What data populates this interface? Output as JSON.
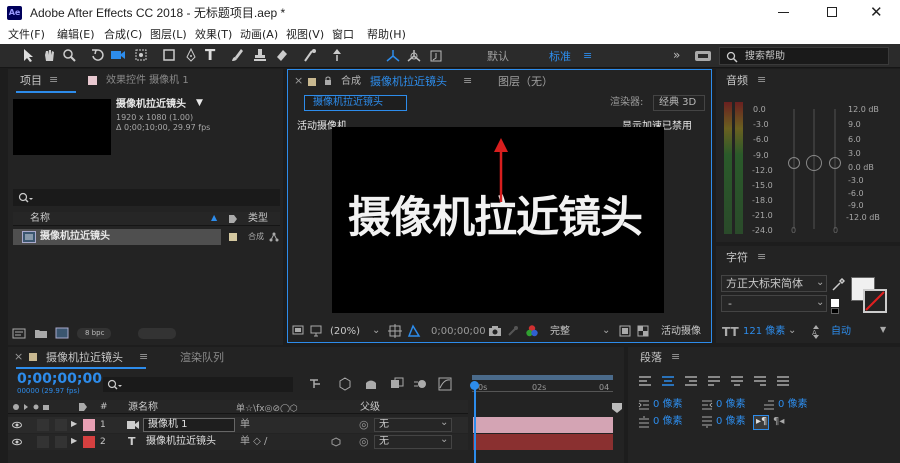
{
  "window": {
    "title": "Adobe After Effects CC 2018 - 无标题项目.aep *",
    "app_badge": "Ae"
  },
  "menu": [
    "文件(F)",
    "编辑(E)",
    "合成(C)",
    "图层(L)",
    "效果(T)",
    "动画(A)",
    "视图(V)",
    "窗口",
    "帮助(H)"
  ],
  "toolbar": {
    "workspace_default": "默认",
    "workspace_standard": "标准",
    "search_placeholder": "搜索帮助"
  },
  "project": {
    "tab": "项目",
    "effects_tab": "效果控件 摄像机 1",
    "comp_name": "摄像机拉近镜头",
    "comp_info1": "1920 x 1080 (1.00)",
    "comp_info2": "Δ 0;00;10;00, 29.97 fps",
    "col_name": "名称",
    "col_type": "类型",
    "item_name": "摄像机拉近镜头",
    "item_type": "合成",
    "bpc": "8 bpc"
  },
  "composition": {
    "tab_prefix": "合成",
    "tab_name": "摄像机拉近镜头",
    "layer_tab": "图层（无）",
    "flow_tab": "摄像机拉近镜头",
    "renderer_label": "渲染器:",
    "renderer_value": "经典 3D",
    "active_camera": "活动摄像机",
    "gpu_notice": "显示加速已禁用",
    "frame_text": "摄像机拉近镜头",
    "zoom": "(20%)",
    "timecode": "0;00;00;00",
    "quality": "完整",
    "view_label": "活动摄像"
  },
  "audio": {
    "title": "音频",
    "left_scale": [
      "0.0",
      "-3.0",
      "-6.0",
      "-9.0",
      "-12.0",
      "-15.0",
      "-18.0",
      "-21.0",
      "-24.0"
    ],
    "right_scale_db": [
      "12.0 dB",
      "",
      "6.0",
      "3.0",
      "0.0 dB",
      "-3.0",
      "-6.0",
      "-9.0",
      "-12.0 dB"
    ],
    "right_scale": [
      "12.0 dB",
      "9.0",
      "6.0",
      "3.0",
      "0.0 dB",
      "-3.0",
      "-6.0",
      "-9.0",
      "-12.0 dB"
    ],
    "slider_bottom": "0"
  },
  "character": {
    "title": "字符",
    "font": "方正大标宋简体",
    "style": "-",
    "size_value": "121 像素",
    "leading_value": "自动"
  },
  "timeline": {
    "tab": "摄像机拉近镜头",
    "render_tab": "渲染队列",
    "timecode": "0;00;00;00",
    "fps_sub": "00000 (29.97 fps)",
    "col_num": "#",
    "col_source": "源名称",
    "col_parent": "父级",
    "time_ticks": [
      "0s",
      "02s",
      "04"
    ],
    "layers": [
      {
        "num": "1",
        "name": "摄像机 1",
        "parent": "无",
        "color": "#e8a0b4"
      },
      {
        "num": "2",
        "name": "摄像机拉近镜头",
        "parent": "无",
        "color": "#d64040"
      }
    ]
  },
  "paragraph": {
    "title": "段落",
    "val1": "0 像素",
    "val2": "0 像素",
    "val3": "0 像素",
    "val4": "0 像素",
    "val5": "0 像素"
  }
}
